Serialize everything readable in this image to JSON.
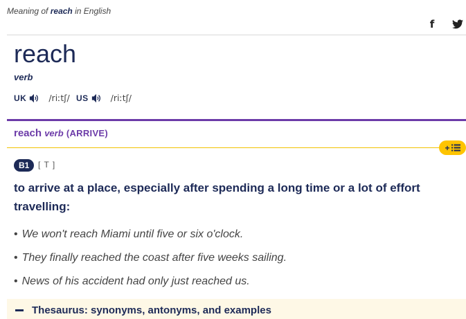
{
  "header": {
    "meaning_prefix": "Meaning of",
    "meaning_word": "reach",
    "meaning_suffix": "in English"
  },
  "social": {
    "facebook_icon": "f",
    "twitter_icon": "twitter-bird"
  },
  "entry": {
    "headword": "reach",
    "pos": "verb",
    "pronunciations": [
      {
        "region": "UK",
        "ipa": "/riːtʃ/"
      },
      {
        "region": "US",
        "ipa": "/riːtʃ/"
      }
    ]
  },
  "sense": {
    "word": "reach",
    "pos": "verb",
    "guideword": "(ARRIVE)",
    "add_to_list_label": "+",
    "level": "B1",
    "grammar": "[ T ]",
    "definition": "to arrive at a place, especially after spending a long time or a lot of effort travelling:",
    "examples": [
      "We won't reach Miami until five or six o'clock.",
      "They finally reached the coast after five weeks sailing.",
      "News of his accident had only just reached us."
    ]
  },
  "thesaurus": {
    "label": "Thesaurus: synonyms, antonyms, and examples"
  },
  "colors": {
    "navy": "#1d2a57",
    "purple": "#6c3ba8",
    "yellow": "#fec400",
    "thesaurus_bg": "#fef8e6"
  }
}
